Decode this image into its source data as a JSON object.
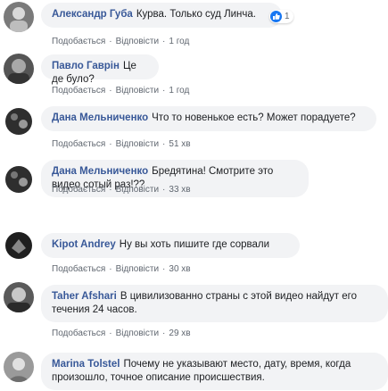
{
  "comments": [
    {
      "author": "Александр Губа",
      "text": "Курва. Только суд Линча.",
      "like": "Подобається",
      "reply": "Відповісти",
      "time": "1 год",
      "reaction_count": "1",
      "avatar_color": "#6d6d6d"
    },
    {
      "author": "Павло Гаврін",
      "text": "Це де було?",
      "like": "Подобається",
      "reply": "Відповісти",
      "time": "1 год",
      "avatar_color": "#4a4a4a"
    },
    {
      "author": "Дана Мельниченко",
      "text": "Что то новенькое есть? Может порадуете?",
      "like": "Подобається",
      "reply": "Відповісти",
      "time": "51 хв",
      "avatar_color": "#2e2e2e"
    },
    {
      "author": "Дана Мельниченко",
      "text": "Бредятина! Смотрите это видео сотый раз!??",
      "like": "Подобається",
      "reply": "Відповісти",
      "time": "33 хв",
      "avatar_color": "#2e2e2e"
    },
    {
      "author": "Kipot Andrey",
      "text": "Ну вы хоть пишите где сорвали",
      "like": "Подобається",
      "reply": "Відповісти",
      "time": "30 хв",
      "avatar_color": "#1f1f1f"
    },
    {
      "author": "Taher Afshari",
      "text": "В цивилизованно страны с этой видео найдут его течения 24 часов.",
      "like": "Подобається",
      "reply": "Відповісти",
      "time": "29 хв",
      "avatar_color": "#3b3b3b"
    },
    {
      "author": "Marina Tolstel",
      "text": "Почему не указывают место, дату, время, когда произошло, точное описание происшествия.",
      "avatar_color": "#8a8a8a"
    }
  ],
  "colors": {
    "author": "#385898",
    "bubble": "#f2f3f5",
    "meta": "#606770",
    "reaction": "#1877f2"
  }
}
